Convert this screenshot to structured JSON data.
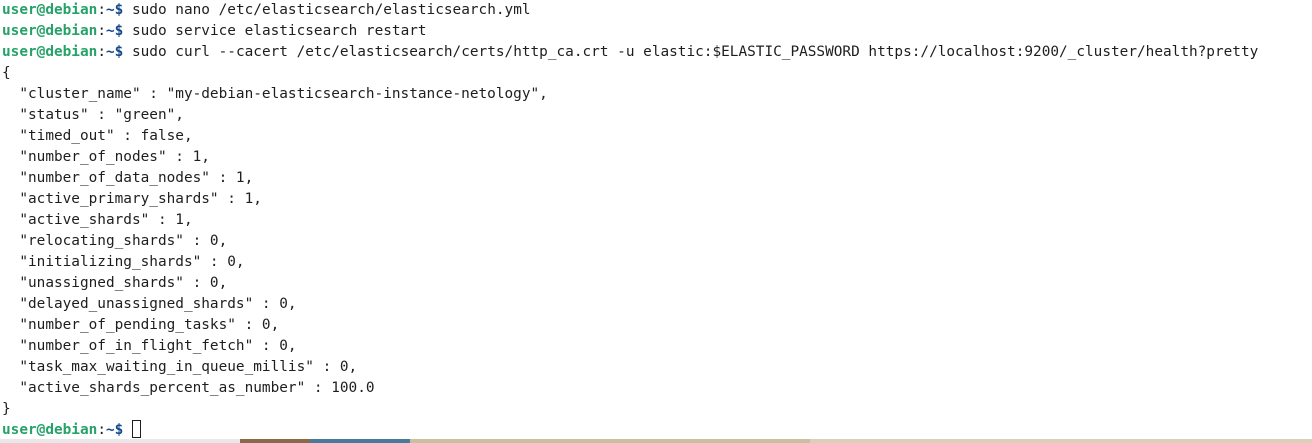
{
  "prompt": {
    "user_host": "user@debian",
    "separator": ":",
    "path_symbol": "~$ "
  },
  "commands": [
    "sudo nano /etc/elasticsearch/elasticsearch.yml",
    "sudo service elasticsearch restart",
    "sudo curl --cacert /etc/elasticsearch/certs/http_ca.crt -u elastic:$ELASTIC_PASSWORD https://localhost:9200/_cluster/health?pretty"
  ],
  "output_lines": [
    "{",
    "  \"cluster_name\" : \"my-debian-elasticsearch-instance-netology\",",
    "  \"status\" : \"green\",",
    "  \"timed_out\" : false,",
    "  \"number_of_nodes\" : 1,",
    "  \"number_of_data_nodes\" : 1,",
    "  \"active_primary_shards\" : 1,",
    "  \"active_shards\" : 1,",
    "  \"relocating_shards\" : 0,",
    "  \"initializing_shards\" : 0,",
    "  \"unassigned_shards\" : 0,",
    "  \"delayed_unassigned_shards\" : 0,",
    "  \"number_of_pending_tasks\" : 0,",
    "  \"number_of_in_flight_fetch\" : 0,",
    "  \"task_max_waiting_in_queue_millis\" : 0,",
    "  \"active_shards_percent_as_number\" : 100.0",
    "}"
  ],
  "colors": {
    "background": "#ffffff",
    "text": "#1e1e1e",
    "prompt_user": "#26a269",
    "prompt_path": "#12488b"
  }
}
